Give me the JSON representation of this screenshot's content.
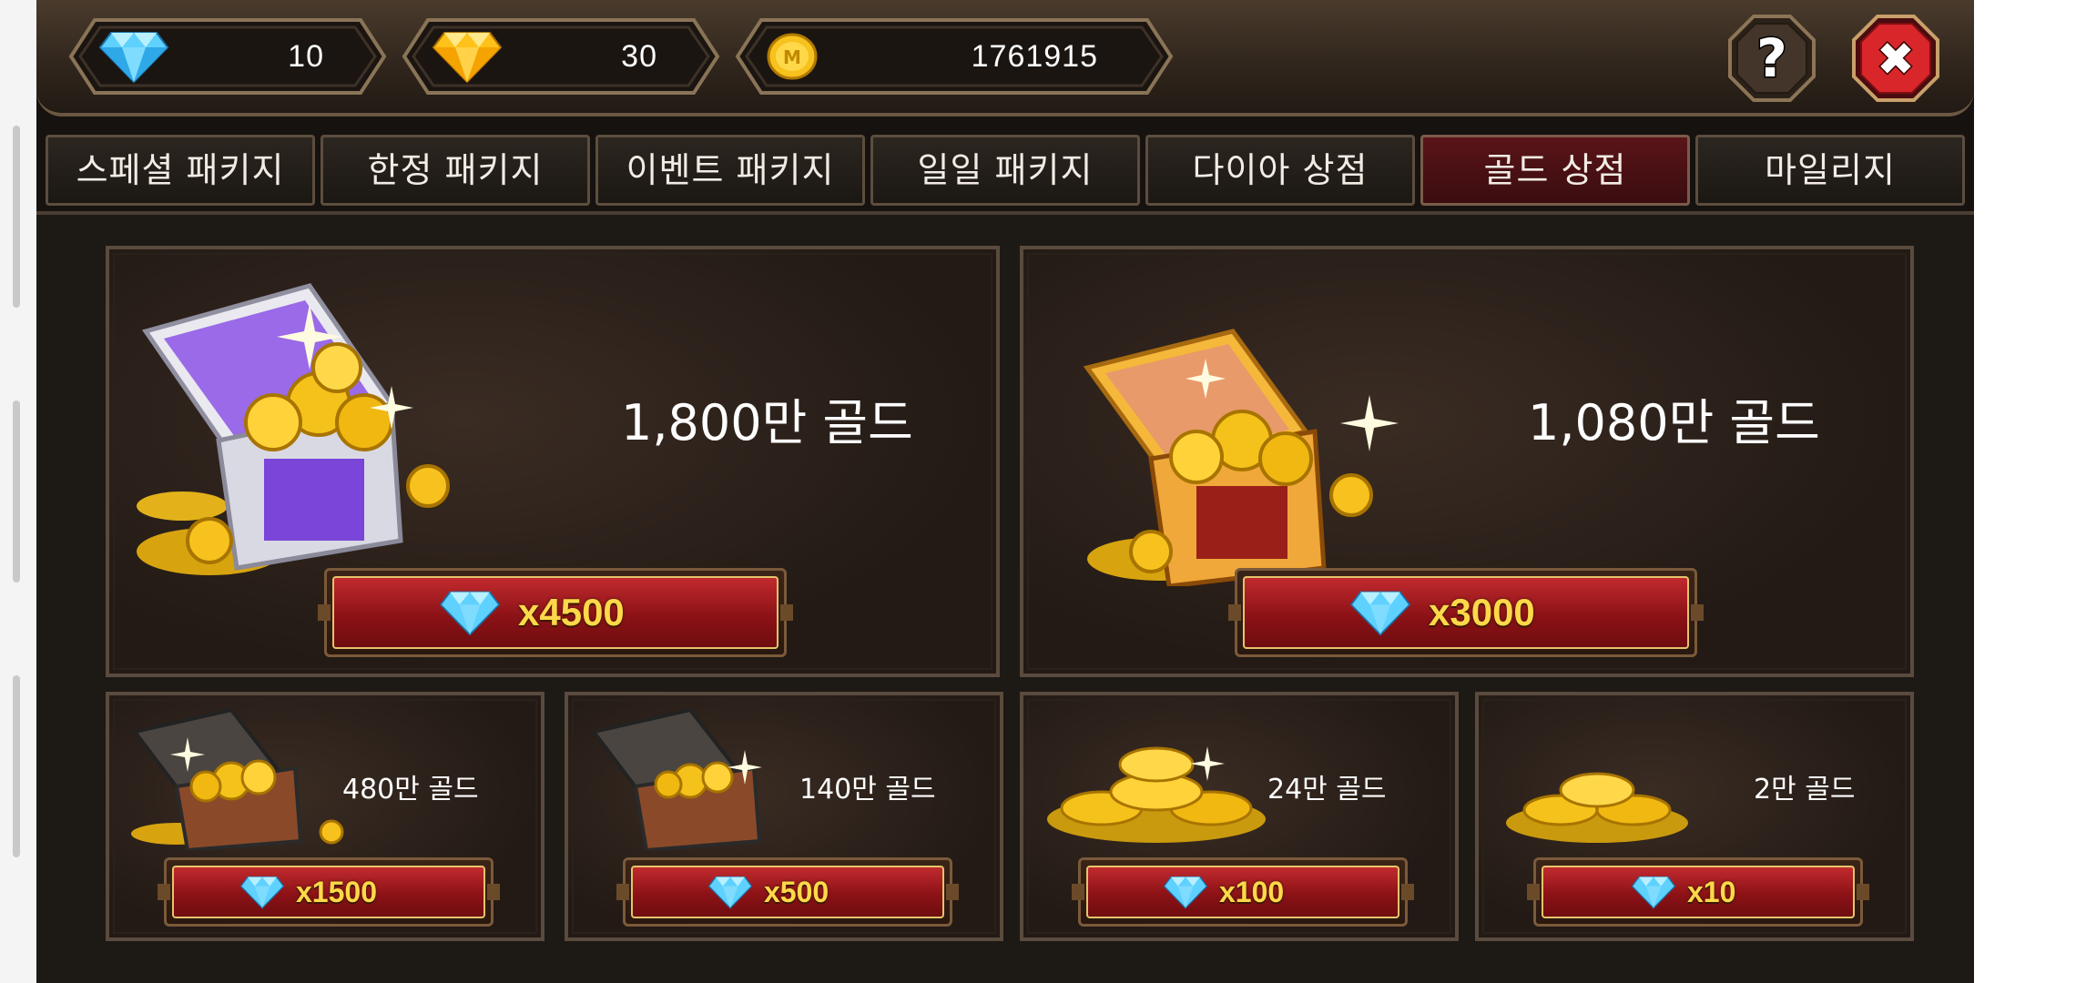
{
  "currencies": {
    "blue_diamond": {
      "value": "10",
      "icon": "blue-diamond-icon"
    },
    "gold_diamond": {
      "value": "30",
      "icon": "gold-diamond-icon"
    },
    "gold_coin": {
      "value": "1761915",
      "icon": "gold-coin-icon",
      "coin_letter": "M"
    }
  },
  "header_buttons": {
    "help": {
      "icon": "help-question-icon",
      "glyph": "?"
    },
    "close": {
      "icon": "close-x-icon",
      "glyph": "✖"
    }
  },
  "tabs": [
    {
      "label": "스페셜 패키지",
      "active": false
    },
    {
      "label": "한정 패키지",
      "active": false
    },
    {
      "label": "이벤트 패키지",
      "active": false
    },
    {
      "label": "일일 패키지",
      "active": false
    },
    {
      "label": "다이아 상점",
      "active": false
    },
    {
      "label": "골드 상점",
      "active": true
    },
    {
      "label": "마일리지",
      "active": false
    }
  ],
  "products": [
    {
      "amount": "1,800만 골드",
      "price": "x4500",
      "image": "purple-treasure-chest"
    },
    {
      "amount": "1,080만 골드",
      "price": "x3000",
      "image": "golden-treasure-chest"
    },
    {
      "amount": "480만 골드",
      "price": "x1500",
      "image": "wooden-chest"
    },
    {
      "amount": "140만 골드",
      "price": "x500",
      "image": "wooden-chest"
    },
    {
      "amount": "24만 골드",
      "price": "x100",
      "image": "coin-pile-large"
    },
    {
      "amount": "2만 골드",
      "price": "x10",
      "image": "coin-pile-small"
    }
  ],
  "colors": {
    "accent_red": "#a01a1e",
    "price_text": "#ffd84a",
    "frame_brown": "#5a4b3e"
  }
}
